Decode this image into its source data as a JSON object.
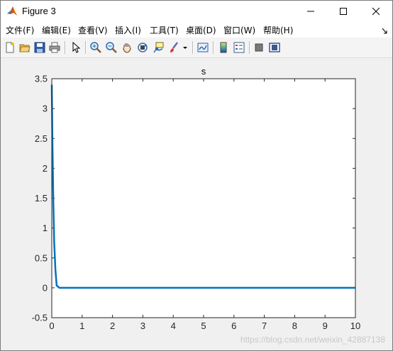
{
  "window": {
    "title": "Figure 3",
    "minimize_glyph": "—",
    "maximize_glyph": "☐",
    "close_glyph": "✕"
  },
  "menu": {
    "items": [
      "文件(F)",
      "编辑(E)",
      "查看(V)",
      "插入(I)",
      "工具(T)",
      "桌面(D)",
      "窗口(W)",
      "帮助(H)"
    ]
  },
  "toolbar": {
    "icons": [
      "new-figure-icon",
      "open-file-icon",
      "save-icon",
      "print-icon",
      "pointer-icon",
      "zoom-in-icon",
      "zoom-out-icon",
      "pan-icon",
      "rotate-3d-icon",
      "data-cursor-icon",
      "brush-icon",
      "link-plot-icon",
      "colorbar-icon",
      "legend-icon",
      "hide-plot-tools-icon",
      "show-plot-tools-icon"
    ]
  },
  "colors": {
    "line": "#0072bd",
    "axes_bg": "#ffffff",
    "figure_bg": "#f0f0f0"
  },
  "chart_data": {
    "type": "line",
    "title": "s",
    "xlabel": "",
    "ylabel": "",
    "xlim": [
      0,
      10
    ],
    "ylim": [
      -0.5,
      3.5
    ],
    "xticks": [
      0,
      1,
      2,
      3,
      4,
      5,
      6,
      7,
      8,
      9,
      10
    ],
    "xtick_labels": [
      "0",
      "1",
      "2",
      "3",
      "4",
      "5",
      "6",
      "7",
      "8",
      "9",
      "10"
    ],
    "yticks": [
      -0.5,
      0,
      0.5,
      1,
      1.5,
      2,
      2.5,
      3,
      3.5
    ],
    "ytick_labels": [
      "-0.5",
      "0",
      "0.5",
      "1",
      "1.5",
      "2",
      "2.5",
      "3",
      "3.5"
    ],
    "grid": false,
    "series": [
      {
        "x": [
          0,
          0.02,
          0.05,
          0.08,
          0.12,
          0.16,
          0.25,
          1,
          5,
          10
        ],
        "y": [
          3.4,
          2.5,
          1.45,
          0.75,
          0.3,
          0.04,
          0,
          0,
          0,
          0
        ]
      }
    ]
  },
  "watermark": "https://blog.csdn.net/weixin_42887138"
}
